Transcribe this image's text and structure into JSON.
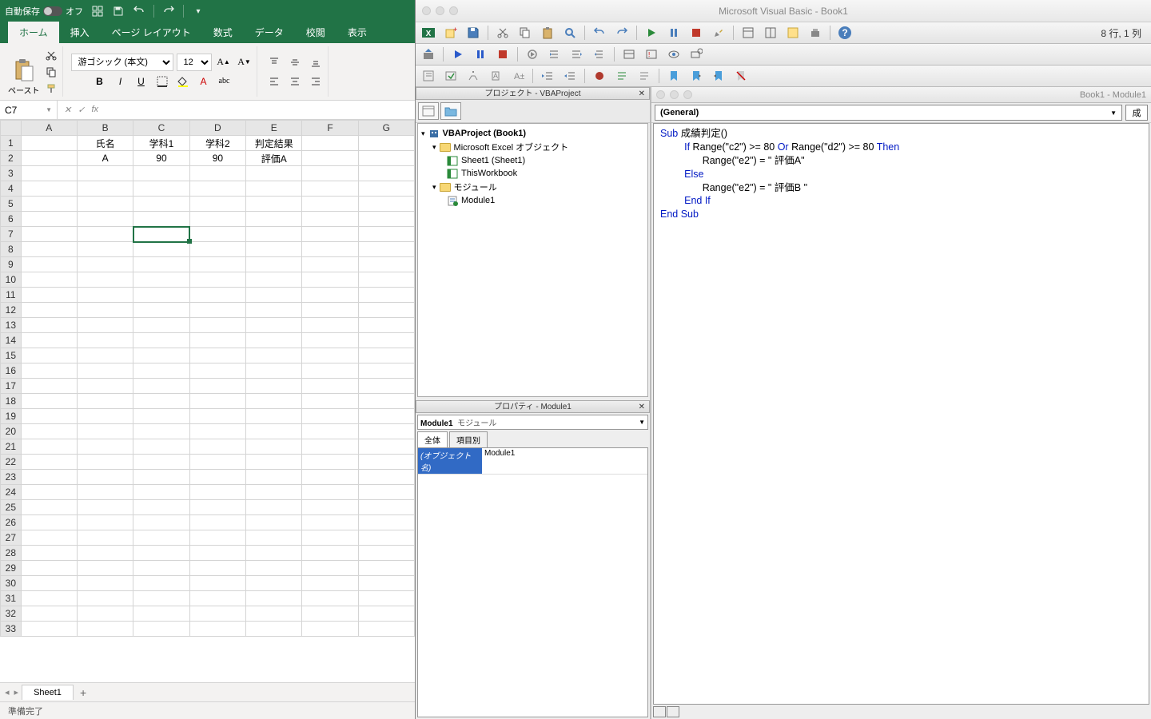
{
  "excel": {
    "autosave_label": "自動保存",
    "autosave_state": "オフ",
    "tabs": [
      "ホーム",
      "挿入",
      "ページ レイアウト",
      "数式",
      "データ",
      "校閲",
      "表示"
    ],
    "active_tab": 0,
    "paste_label": "ペースト",
    "font_name": "游ゴシック (本文)",
    "font_size": "12",
    "name_box": "C7",
    "columns": [
      "A",
      "B",
      "C",
      "D",
      "E",
      "F",
      "G"
    ],
    "row_count": 33,
    "data": {
      "1": {
        "B": "氏名",
        "C": "学科1",
        "D": "学科2",
        "E": "判定結果"
      },
      "2": {
        "B": "A",
        "C": "90",
        "D": "90",
        "E": "評価A"
      }
    },
    "selected": {
      "row": 7,
      "col": "C"
    },
    "sheet_tab": "Sheet1",
    "status": "準備完了"
  },
  "vbe": {
    "title": "Microsoft Visual Basic - Book1",
    "cursor_pos": "8 行, 1 列",
    "project_pane_title": "プロジェクト - VBAProject",
    "project_root": "VBAProject (Book1)",
    "folder_objects": "Microsoft Excel オブジェクト",
    "obj_sheet": "Sheet1 (Sheet1)",
    "obj_workbook": "ThisWorkbook",
    "folder_modules": "モジュール",
    "module1": "Module1",
    "props_pane_title": "プロパティ - Module1",
    "props_selector": "Module1  モジュール",
    "props_tab_all": "全体",
    "props_tab_cat": "項目別",
    "props_key": "(オブジェクト名)",
    "props_val": "Module1",
    "code_title": "Book1 - Module1",
    "general_dd": "(General)",
    "proc_dd": "成",
    "code": {
      "l1a": "Sub",
      "l1b": " 成績判定()",
      "l2a": "If",
      "l2b": " Range(\"c2\") >= 80 ",
      "l2c": "Or",
      "l2d": " Range(\"d2\") >= 80 ",
      "l2e": "Then",
      "l3": "Range(\"e2\") = \" 評価A\"",
      "l4": "Else",
      "l5": "Range(\"e2\") = \" 評価B \"",
      "l6": "End If",
      "l7": "End Sub"
    }
  }
}
